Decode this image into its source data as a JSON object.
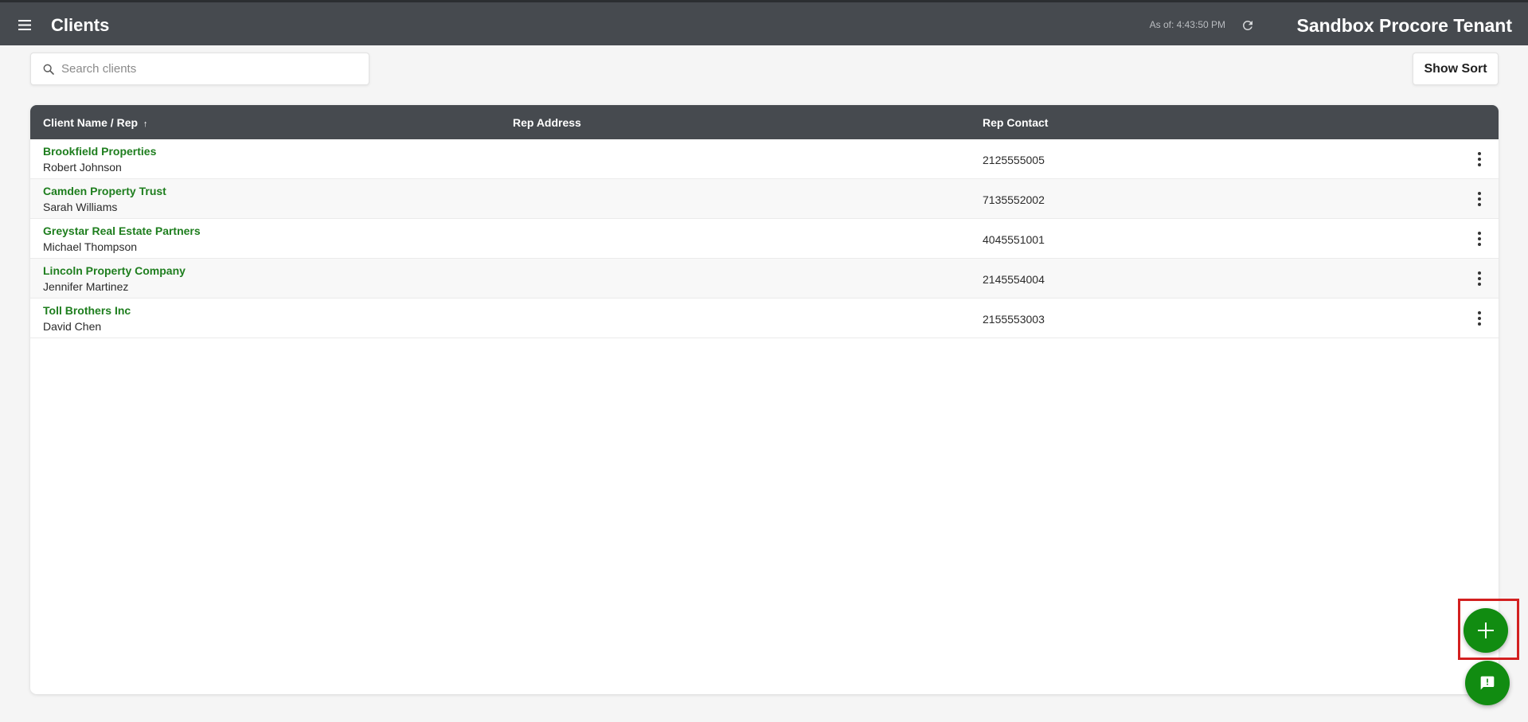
{
  "header": {
    "title": "Clients",
    "as_of": "As of: 4:43:50 PM",
    "tenant": "Sandbox Procore Tenant",
    "menu_icon": "hamburger-menu-icon",
    "refresh_icon": "refresh-icon"
  },
  "search": {
    "placeholder": "Search clients",
    "value": ""
  },
  "toolbar": {
    "show_sort_label": "Show Sort"
  },
  "table": {
    "columns": [
      {
        "label": "Client Name / Rep",
        "sort_indicator": "↑"
      },
      {
        "label": "Rep Address"
      },
      {
        "label": "Rep Contact"
      }
    ],
    "rows": [
      {
        "client": "Brookfield Properties",
        "rep": "Robert Johnson",
        "address": "",
        "contact": "2125555005"
      },
      {
        "client": "Camden Property Trust",
        "rep": "Sarah Williams",
        "address": "",
        "contact": "7135552002"
      },
      {
        "client": "Greystar Real Estate Partners",
        "rep": "Michael Thompson",
        "address": "",
        "contact": "4045551001"
      },
      {
        "client": "Lincoln Property Company",
        "rep": "Jennifer Martinez",
        "address": "",
        "contact": "2145554004"
      },
      {
        "client": "Toll Brothers Inc",
        "rep": "David Chen",
        "address": "",
        "contact": "2155553003"
      }
    ]
  },
  "colors": {
    "header_bg": "#464a4f",
    "accent_green": "#118c11",
    "link_green": "#1e7e1e",
    "highlight_red": "#d32020"
  },
  "fab": {
    "add_icon": "plus-icon",
    "feedback_icon": "feedback-chat-icon"
  }
}
